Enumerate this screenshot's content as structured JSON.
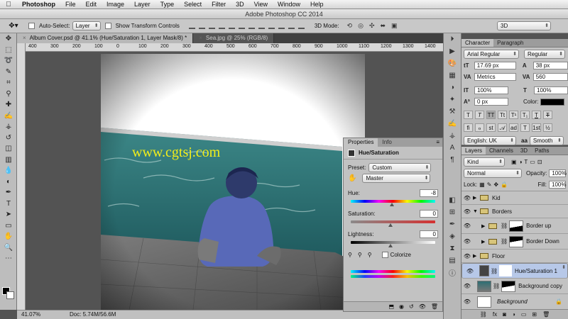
{
  "menubar": {
    "app": "Photoshop",
    "items": [
      "File",
      "Edit",
      "Image",
      "Layer",
      "Type",
      "Select",
      "Filter",
      "3D",
      "View",
      "Window",
      "Help"
    ]
  },
  "window_title": "Adobe Photoshop CC 2014",
  "options_bar": {
    "auto_select_label": "Auto-Select:",
    "auto_select_value": "Layer",
    "show_transform_label": "Show Transform Controls",
    "mode_3d_label": "3D Mode:",
    "workspace_value": "3D"
  },
  "doc_tabs": [
    {
      "label": "Album Cover.psd @ 41.1% (Hue/Saturation 1, Layer Mask/8) *",
      "active": true
    },
    {
      "label": "Sea.jpg @ 25% (RGB/8)",
      "active": false
    }
  ],
  "ruler_ticks": [
    "400",
    "300",
    "200",
    "100",
    "0",
    "100",
    "200",
    "300",
    "400",
    "500",
    "600",
    "700",
    "800",
    "900",
    "1000",
    "1100",
    "1200",
    "1300",
    "1400"
  ],
  "watermark": "www.cgtsj.com",
  "status_bar": {
    "zoom": "41.07%",
    "doc": "Doc: 5.74M/56.6M"
  },
  "properties_panel": {
    "tabs": [
      "Properties",
      "Info"
    ],
    "title": "Hue/Saturation",
    "preset_label": "Preset:",
    "preset_value": "Custom",
    "channel_value": "Master",
    "hue_label": "Hue:",
    "hue_value": "-8",
    "hue_fraction": 0.49,
    "saturation_label": "Saturation:",
    "saturation_value": "0",
    "lightness_label": "Lightness:",
    "lightness_value": "0",
    "colorize_label": "Colorize"
  },
  "character_panel": {
    "tabs": [
      "Character",
      "Paragraph"
    ],
    "font_family": "Arial Regular",
    "font_style": "Regular",
    "font_size": "17.69 px",
    "leading": "38 px",
    "kerning": "Metrics",
    "tracking": "560",
    "vertical_scale": "100%",
    "horizontal_scale": "100%",
    "baseline_shift": "0 px",
    "color_label": "Color:",
    "language": "English: UK",
    "antialias": "Smooth",
    "aa_label": "aa"
  },
  "layers_panel": {
    "tabs": [
      "Layers",
      "Channels",
      "3D",
      "Paths"
    ],
    "filter_kind": "Kind",
    "blend_mode": "Normal",
    "opacity_label": "Opacity:",
    "opacity_value": "100%",
    "lock_label": "Lock:",
    "fill_label": "Fill:",
    "fill_value": "100%",
    "layers": [
      {
        "name": "Kid",
        "type": "group",
        "indent": 0,
        "expanded": false
      },
      {
        "name": "Borders",
        "type": "group",
        "indent": 0,
        "expanded": true
      },
      {
        "name": "Border up",
        "type": "group",
        "indent": 1,
        "expanded": false
      },
      {
        "name": "Border Down",
        "type": "group",
        "indent": 1,
        "expanded": false
      },
      {
        "name": "Floor",
        "type": "group",
        "indent": 0,
        "expanded": false
      },
      {
        "name": "Hue/Saturation 1",
        "type": "adjustment",
        "indent": 0,
        "selected": true
      },
      {
        "name": "Background copy",
        "type": "pixel",
        "indent": 0
      },
      {
        "name": "Background",
        "type": "background",
        "indent": 0
      }
    ]
  },
  "colors": {
    "ui_bg": "#535353",
    "panel": "#c2c2c2",
    "selected_layer": "#b7c8e8",
    "watermark": "#f2ee1a",
    "water": "#2e6e73"
  }
}
